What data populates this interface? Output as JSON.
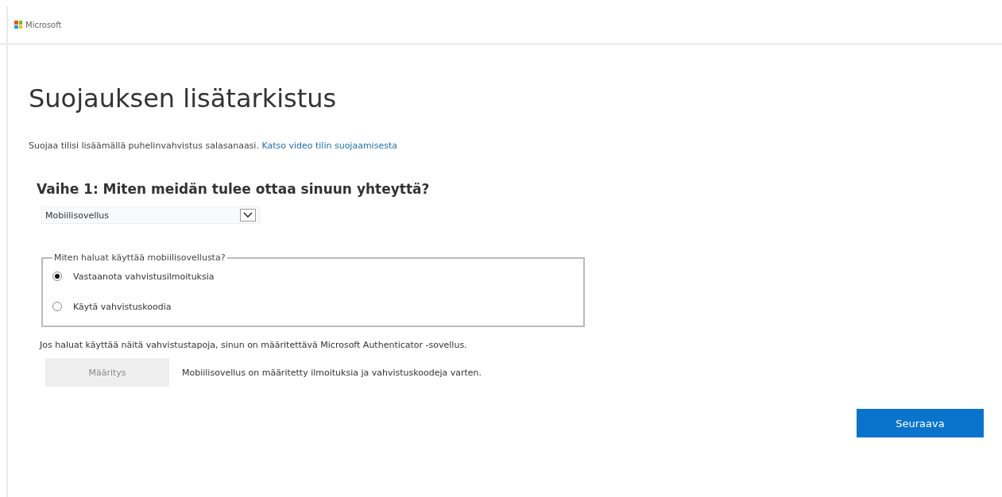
{
  "header": {
    "brand": "Microsoft"
  },
  "title": "Suojauksen lisätarkistus",
  "intro": {
    "text": "Suojaa tilisi lisäämällä puhelinvahvistus salasanaasi.",
    "link": "Katso video tilin suojaamisesta"
  },
  "step_heading": "Vaihe 1: Miten meidän tulee ottaa sinuun yhteyttä?",
  "contact_method": {
    "value": "Mobiilisovellus"
  },
  "fieldset": {
    "legend": "Miten haluat käyttää mobiilisovellusta?",
    "options": [
      {
        "label": "Vastaanota vahvistusilmoituksia",
        "selected": true
      },
      {
        "label": "Käytä vahvistuskoodia",
        "selected": false
      }
    ]
  },
  "note": "Jos haluat käyttää näitä vahvistustapoja, sinun on määritettävä Microsoft Authenticator -sovellus.",
  "setup": {
    "label": "Määritys",
    "disabled": true,
    "status": "Mobiilisovellus on määritetty ilmoituksia ja vahvistuskoodeja varten."
  },
  "next_button": "Seuraava"
}
